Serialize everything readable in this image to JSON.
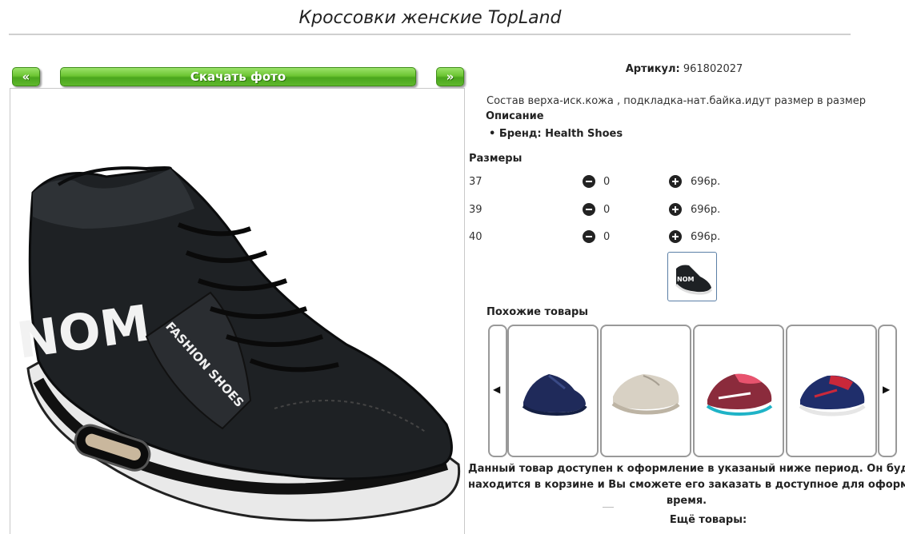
{
  "product": {
    "title": "Кроссовки женские TopLand",
    "download_label": "Скачать фото",
    "prev_label": "«",
    "next_label": "»",
    "article_label": "Артикул:",
    "article_value": "961802027",
    "composition": "Состав верха-иск.кожа , подкладка-нат.байка.идут размер в размер",
    "description_heading": "Описание",
    "brand": "Бренд: Health Shoes",
    "sizes_heading": "Размеры",
    "sizes": [
      {
        "size": "37",
        "qty": "0",
        "price": "696р."
      },
      {
        "size": "39",
        "qty": "0",
        "price": "696р."
      },
      {
        "size": "40",
        "qty": "0",
        "price": "696р."
      }
    ]
  },
  "similar": {
    "heading": "Похожие товары",
    "prev_icon": "skip-back-icon",
    "next_icon": "skip-forward-icon",
    "items": [
      {
        "name": "navy-sneaker"
      },
      {
        "name": "beige-knit-sneaker"
      },
      {
        "name": "pink-running-shoe"
      },
      {
        "name": "navy-red-sneaker"
      }
    ]
  },
  "notice": {
    "line1": "Данный товар доступен к оформление в указаный ниже период. Он будет",
    "line2": "находится в корзине и Вы сможете его заказать в доступное для оформлени",
    "line3": "время."
  },
  "more": {
    "heading": "Ещё товары:"
  }
}
